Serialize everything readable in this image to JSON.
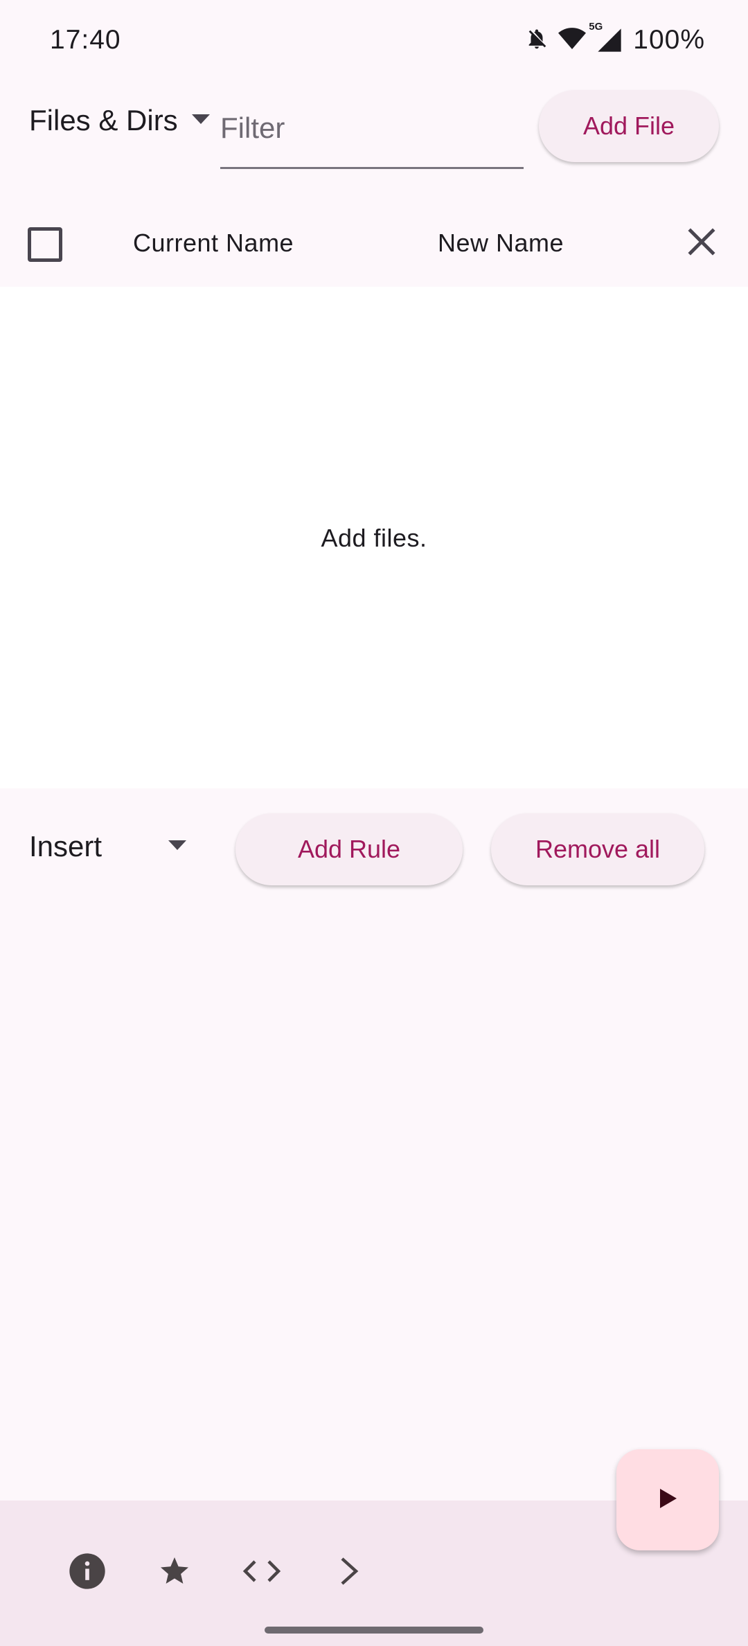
{
  "status_bar": {
    "time": "17:40",
    "battery": "100%",
    "network_badge": "5G",
    "icons": [
      "notifications-off-icon",
      "wifi-icon",
      "signal-5g-icon"
    ]
  },
  "toolbar": {
    "type_select": "Files & Dirs",
    "filter_placeholder": "Filter",
    "filter_value": "",
    "add_file_label": "Add File"
  },
  "file_table": {
    "select_all_checked": false,
    "columns": [
      "Current Name",
      "New Name"
    ],
    "empty_message": "Add files."
  },
  "rules": {
    "rule_type": "Insert",
    "add_rule_label": "Add Rule",
    "remove_all_label": "Remove all"
  },
  "bottom_nav": {
    "icons": [
      "info-icon",
      "star-icon",
      "code-icon",
      "chevron-right-icon"
    ],
    "fab_icon": "play-icon"
  },
  "colors": {
    "accent_text": "#a0195c",
    "background": "#fdf7fb",
    "bottom_bar": "#f4e6ef",
    "fab": "#ffdde3"
  }
}
